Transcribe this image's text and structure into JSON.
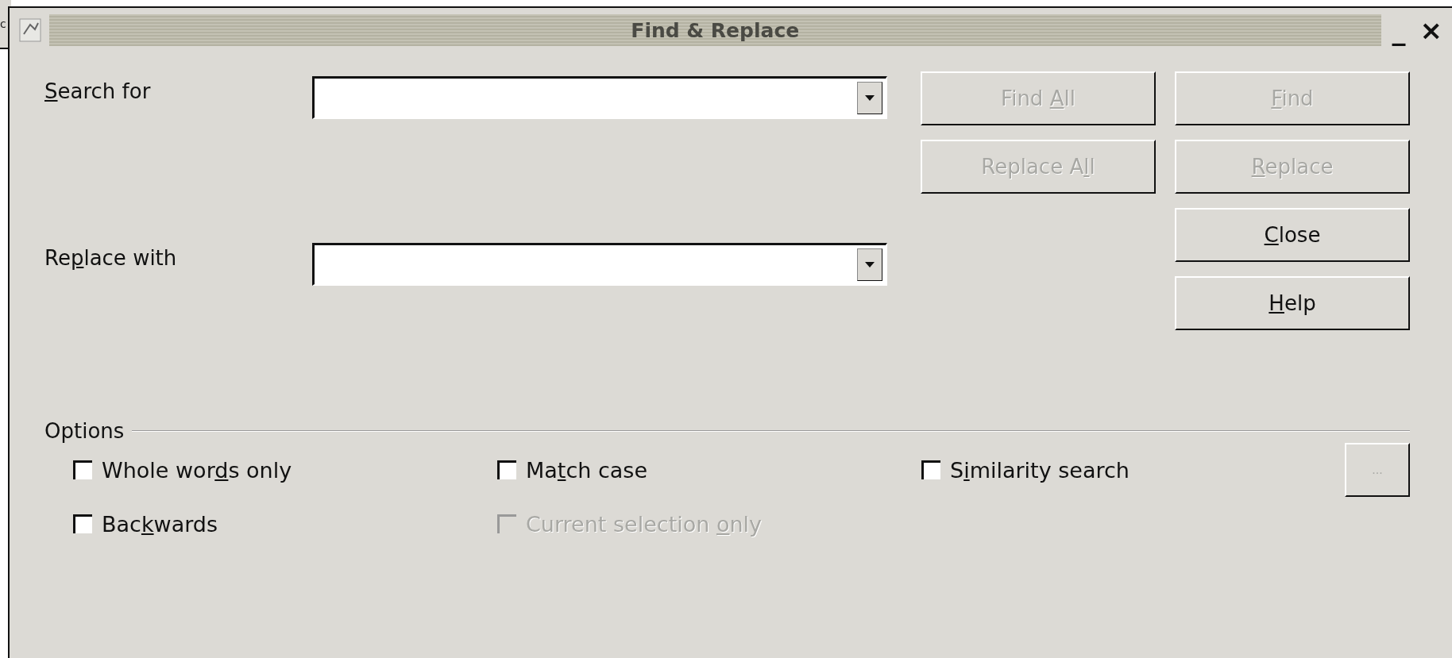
{
  "background_window": {
    "text": "c"
  },
  "window": {
    "title": "Find & Replace",
    "controls": [
      "_",
      "×"
    ]
  },
  "fields": [
    {
      "label": {
        "key": "S",
        "post": "earch for"
      }
    },
    {
      "label": {
        "pre": "Re",
        "key": "p",
        "post": "lace with"
      }
    }
  ],
  "buttons": [
    {
      "label": {
        "pre": "Find ",
        "key": "A",
        "post": "ll"
      },
      "disabled": true
    },
    {
      "label": {
        "key": "F",
        "post": "ind"
      },
      "disabled": true
    },
    {
      "label": {
        "pre": "Replace A",
        "key": "l",
        "post": "l"
      },
      "disabled": true
    },
    {
      "label": {
        "key": "R",
        "post": "eplace"
      },
      "disabled": true
    },
    {
      "label": {
        "key": "C",
        "post": "lose"
      },
      "disabled": false
    },
    {
      "label": {
        "key": "H",
        "post": "elp"
      },
      "disabled": false
    }
  ],
  "options": {
    "title": "Options",
    "checkboxes": [
      {
        "label": {
          "pre": "Whole wor",
          "key": "d",
          "post": "s only"
        },
        "checked": false,
        "disabled": false
      },
      {
        "label": {
          "pre": "Ma",
          "key": "t",
          "post": "ch case"
        },
        "checked": false,
        "disabled": false
      },
      {
        "label": {
          "pre": "S",
          "key": "i",
          "post": "milarity search"
        },
        "checked": false,
        "disabled": false
      },
      {
        "label": {
          "pre": "Bac",
          "key": "k",
          "post": "wards"
        },
        "checked": false,
        "disabled": false
      },
      {
        "label": {
          "pre": "Current selection ",
          "key": "o",
          "post": "nly"
        },
        "checked": false,
        "disabled": true
      }
    ],
    "more_button": {
      "label": "...",
      "disabled": true
    }
  }
}
